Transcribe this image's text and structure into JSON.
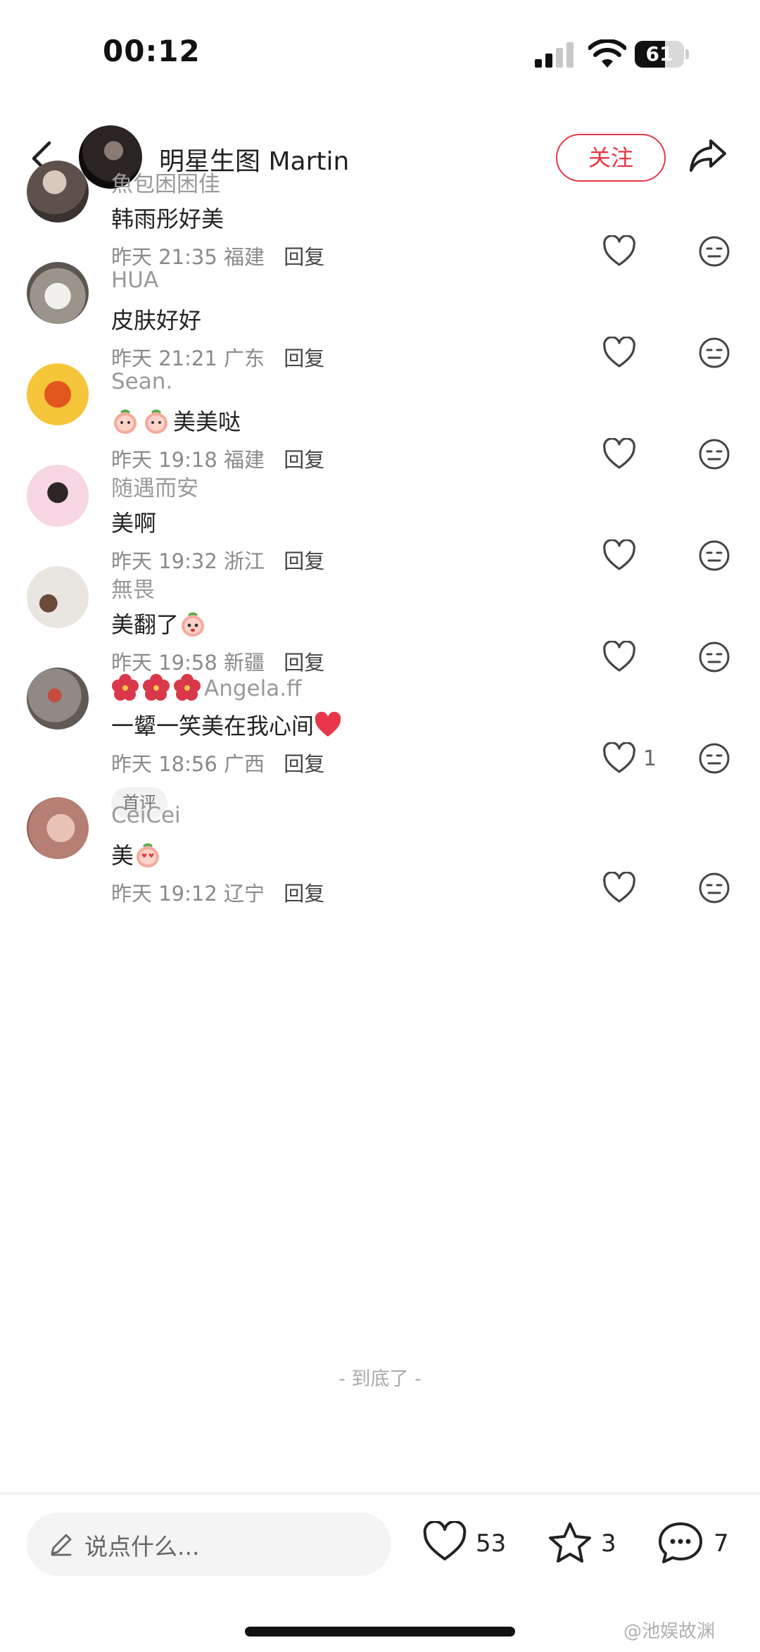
{
  "status_bar": {
    "time": "00:12",
    "battery": "61",
    "battery_level": 0.61
  },
  "header": {
    "author": "明星生图 Martin",
    "follow_label": "关注"
  },
  "comments": [
    {
      "user": "魚包困困佳",
      "text": "韩雨彤好美",
      "date": "昨天 21:35",
      "location": "福建",
      "reply": "回复",
      "likes": "",
      "avatar_color": "#6b5f5a"
    },
    {
      "user": "HUA",
      "text": "皮肤好好",
      "date": "昨天 21:21",
      "location": "广东",
      "reply": "回复",
      "likes": "",
      "avatar_color": "#b9b4ab"
    },
    {
      "user": "Sean.",
      "text": "美美哒",
      "date": "昨天 19:18",
      "location": "福建",
      "reply": "回复",
      "likes": "",
      "avatar_color": "#f0b429"
    },
    {
      "user": "随遇而安",
      "text": "美啊",
      "date": "昨天 19:32",
      "location": "浙江",
      "reply": "回复",
      "likes": "",
      "avatar_color": "#f7d7e4"
    },
    {
      "user": "無畏",
      "text": "美翻了",
      "date": "昨天 19:58",
      "location": "新疆",
      "reply": "回复",
      "likes": "",
      "avatar_color": "#e9e6e1"
    },
    {
      "user": "Angela.ff",
      "text": "一颦一笑美在我心间",
      "date": "昨天 18:56",
      "location": "广西",
      "reply": "回复",
      "likes": "1",
      "badge": "首评",
      "avatar_color": "#8f8a86"
    },
    {
      "user": "CeiCei",
      "text": "美",
      "date": "昨天 19:12",
      "location": "辽宁",
      "reply": "回复",
      "likes": "",
      "avatar_color": "#c9938a"
    }
  ],
  "end_marker": "- 到底了 -",
  "bottom_bar": {
    "input_placeholder": "说点什么...",
    "likes": "53",
    "stars": "3",
    "comments": "7"
  },
  "watermark": "@池娱故渊",
  "colors": {
    "accent": "#e53946"
  },
  "icons": [
    "back-icon",
    "share-icon",
    "heart-icon",
    "dislike-face-icon",
    "pencil-icon",
    "star-icon",
    "chat-bubble-icon",
    "wifi-icon",
    "signal-icon"
  ]
}
